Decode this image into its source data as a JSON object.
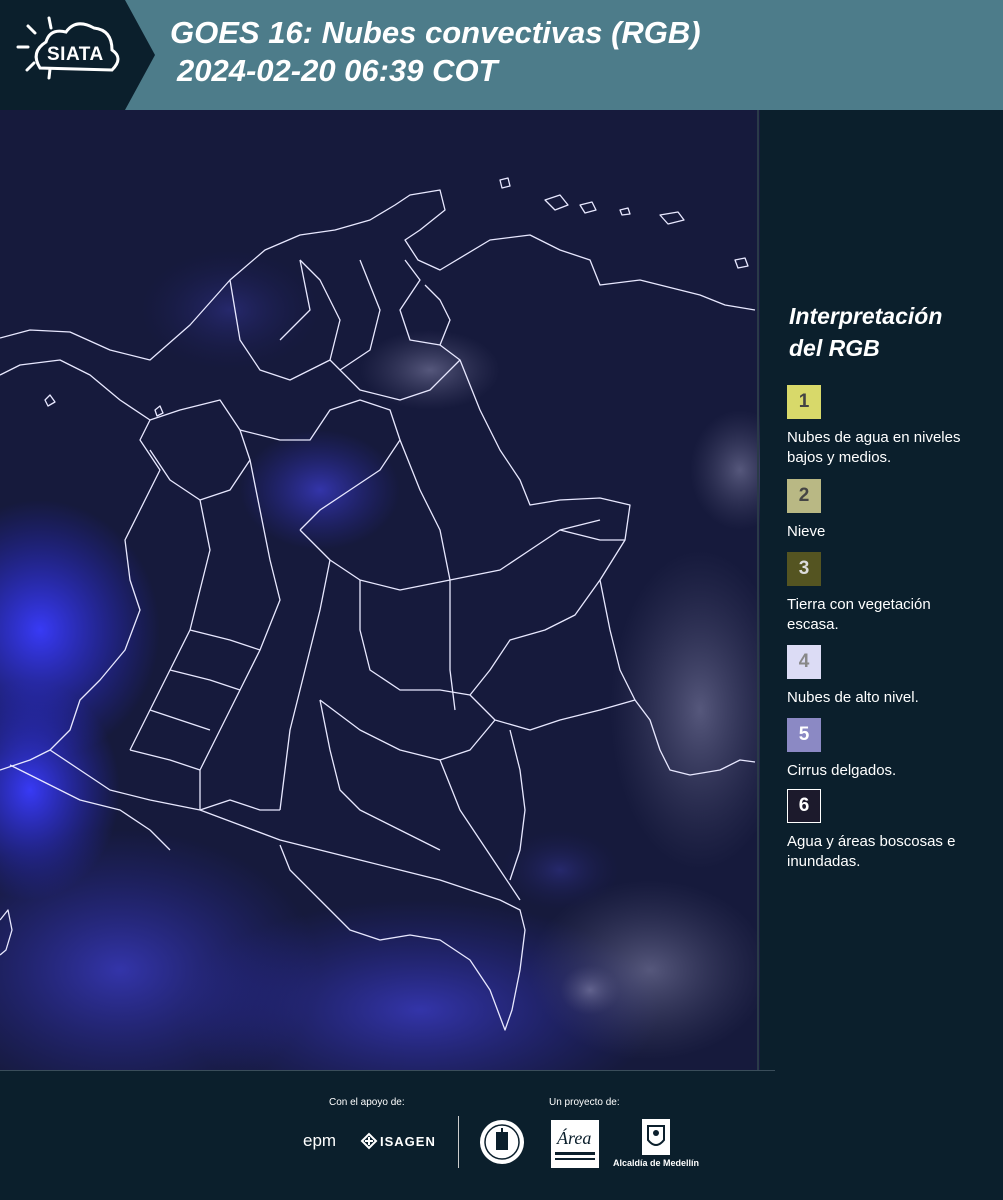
{
  "header": {
    "logo_text": "SIATA",
    "title_line1": "GOES 16: Nubes convectivas (RGB)",
    "title_line2": "2024-02-20 06:39 COT"
  },
  "map": {
    "description_icon": "satellite-map-colombia"
  },
  "legend": {
    "title_line1": "Interpretación",
    "title_line2": "del RGB",
    "items": [
      {
        "number": "1",
        "label": "Nubes de agua en niveles bajos y medios.",
        "color": "#d8d96a"
      },
      {
        "number": "2",
        "label": "Nieve",
        "color": "#b9b884"
      },
      {
        "number": "3",
        "label": "Tierra con vegetación escasa.",
        "color": "#545421"
      },
      {
        "number": "4",
        "label": "Nubes de alto nivel.",
        "color": "#dcdcf5"
      },
      {
        "number": "5",
        "label": "Cirrus delgados.",
        "color": "#8b89c4"
      },
      {
        "number": "6",
        "label": "Agua y áreas boscosas e inundadas.",
        "color": "#1c1a2c"
      }
    ]
  },
  "footer": {
    "support_label": "Con el apoyo de:",
    "project_label": "Un proyecto de:",
    "epm_logo_text": "epm",
    "isagen_logo_text": "ISAGEN",
    "metropolitana_logo_text": "Área",
    "alcaldia_label": "Alcaldía de Medellín"
  }
}
